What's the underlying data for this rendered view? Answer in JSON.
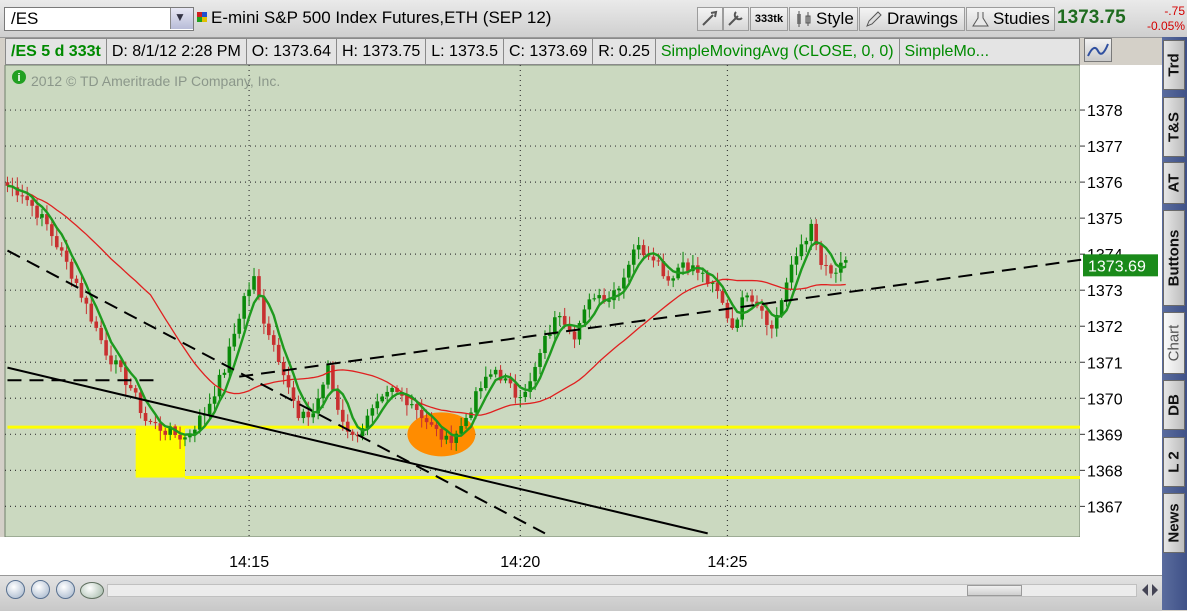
{
  "header": {
    "symbol": "/ES",
    "instrument": "E-mini S&P 500 Index Futures,ETH (SEP 12)",
    "aggregation_badge": "333tk",
    "style_label": "Style",
    "drawings_label": "Drawings",
    "studies_label": "Studies",
    "last_price": "1373.75",
    "net_change": "-.75",
    "pct_change": "-0.05%"
  },
  "infobar": {
    "symbol_period": "/ES 5 d 333t",
    "date": "D: 8/1/12 2:28 PM",
    "open": "O: 1373.64",
    "high": "H: 1373.75",
    "low": "L: 1373.5",
    "close": "C: 1373.69",
    "range": "R: 0.25",
    "study1": "SimpleMovingAvg (CLOSE, 0, 0)",
    "study2": "SimpleMo..."
  },
  "copyright": "2012 © TD Ameritrade IP Company, Inc.",
  "price_label": "1373.69",
  "side_tabs": [
    "Trd",
    "T&S",
    "AT",
    "Buttons",
    "Chart",
    "DB",
    "L 2",
    "News"
  ],
  "colors": {
    "up": "#0a8a0a",
    "down": "#c83030",
    "ma_fast": "#1e9a1e",
    "ma_slow": "#e02020",
    "highlight": "#ffff00",
    "orange": "#ff8c00",
    "plot_bg": "#cbd9c0"
  },
  "chart_data": {
    "type": "candlestick",
    "y_ticks": [
      1367,
      1368,
      1369,
      1370,
      1371,
      1372,
      1373,
      1374,
      1375,
      1376,
      1377,
      1378
    ],
    "ylim": [
      1366.15,
      1379.25
    ],
    "x_ticks": [
      {
        "label": "14:15",
        "bar": 49
      },
      {
        "label": "14:20",
        "bar": 104
      },
      {
        "label": "14:25",
        "bar": 146
      }
    ],
    "bar_count": 218,
    "close_path": [
      [
        0,
        1375.9
      ],
      [
        3,
        1375.7
      ],
      [
        8,
        1374.8
      ],
      [
        14,
        1373.2
      ],
      [
        20,
        1371.3
      ],
      [
        25,
        1370.3
      ],
      [
        28,
        1369.4
      ],
      [
        32,
        1369.1
      ],
      [
        36,
        1368.9
      ],
      [
        40,
        1369.6
      ],
      [
        44,
        1370.8
      ],
      [
        48,
        1372.8
      ],
      [
        50,
        1373.3
      ],
      [
        52,
        1372.2
      ],
      [
        56,
        1370.8
      ],
      [
        59,
        1369.4
      ],
      [
        62,
        1369.6
      ],
      [
        65,
        1370.8
      ],
      [
        67,
        1369.7
      ],
      [
        70,
        1368.9
      ],
      [
        74,
        1369.6
      ],
      [
        78,
        1370.2
      ],
      [
        82,
        1369.9
      ],
      [
        86,
        1369.2
      ],
      [
        89,
        1368.8
      ],
      [
        92,
        1369.2
      ],
      [
        96,
        1370.3
      ],
      [
        99,
        1370.8
      ],
      [
        103,
        1370.1
      ],
      [
        106,
        1370.4
      ],
      [
        109,
        1371.6
      ],
      [
        112,
        1372.4
      ],
      [
        115,
        1371.8
      ],
      [
        119,
        1372.9
      ],
      [
        122,
        1372.8
      ],
      [
        125,
        1373.4
      ],
      [
        127,
        1374.2
      ],
      [
        131,
        1374.0
      ],
      [
        134,
        1373.3
      ],
      [
        137,
        1373.8
      ],
      [
        141,
        1373.4
      ],
      [
        144,
        1372.9
      ],
      [
        147,
        1372.0
      ],
      [
        150,
        1373.0
      ],
      [
        153,
        1372.5
      ],
      [
        155,
        1371.9
      ],
      [
        158,
        1373.2
      ],
      [
        161,
        1374.3
      ],
      [
        163,
        1374.7
      ],
      [
        165,
        1373.7
      ],
      [
        167,
        1373.4
      ],
      [
        170,
        1373.7
      ]
    ],
    "series": [
      {
        "name": "SimpleMovingAvg (CLOSE, 0, 0)",
        "period": 5
      },
      {
        "name": "SimpleMo...",
        "period": 30
      }
    ],
    "drawings": [
      {
        "kind": "support",
        "y": 1369.2,
        "x_from_bar": 0
      },
      {
        "kind": "support",
        "y": 1367.8,
        "x_from_bar": 36
      },
      {
        "kind": "highlight_box",
        "bar_from": 26,
        "bar_to": 36,
        "y_from": 1367.8,
        "y_to": 1369.2
      },
      {
        "kind": "ellipse",
        "bar_center": 88,
        "y_center": 1369.0
      }
    ]
  }
}
